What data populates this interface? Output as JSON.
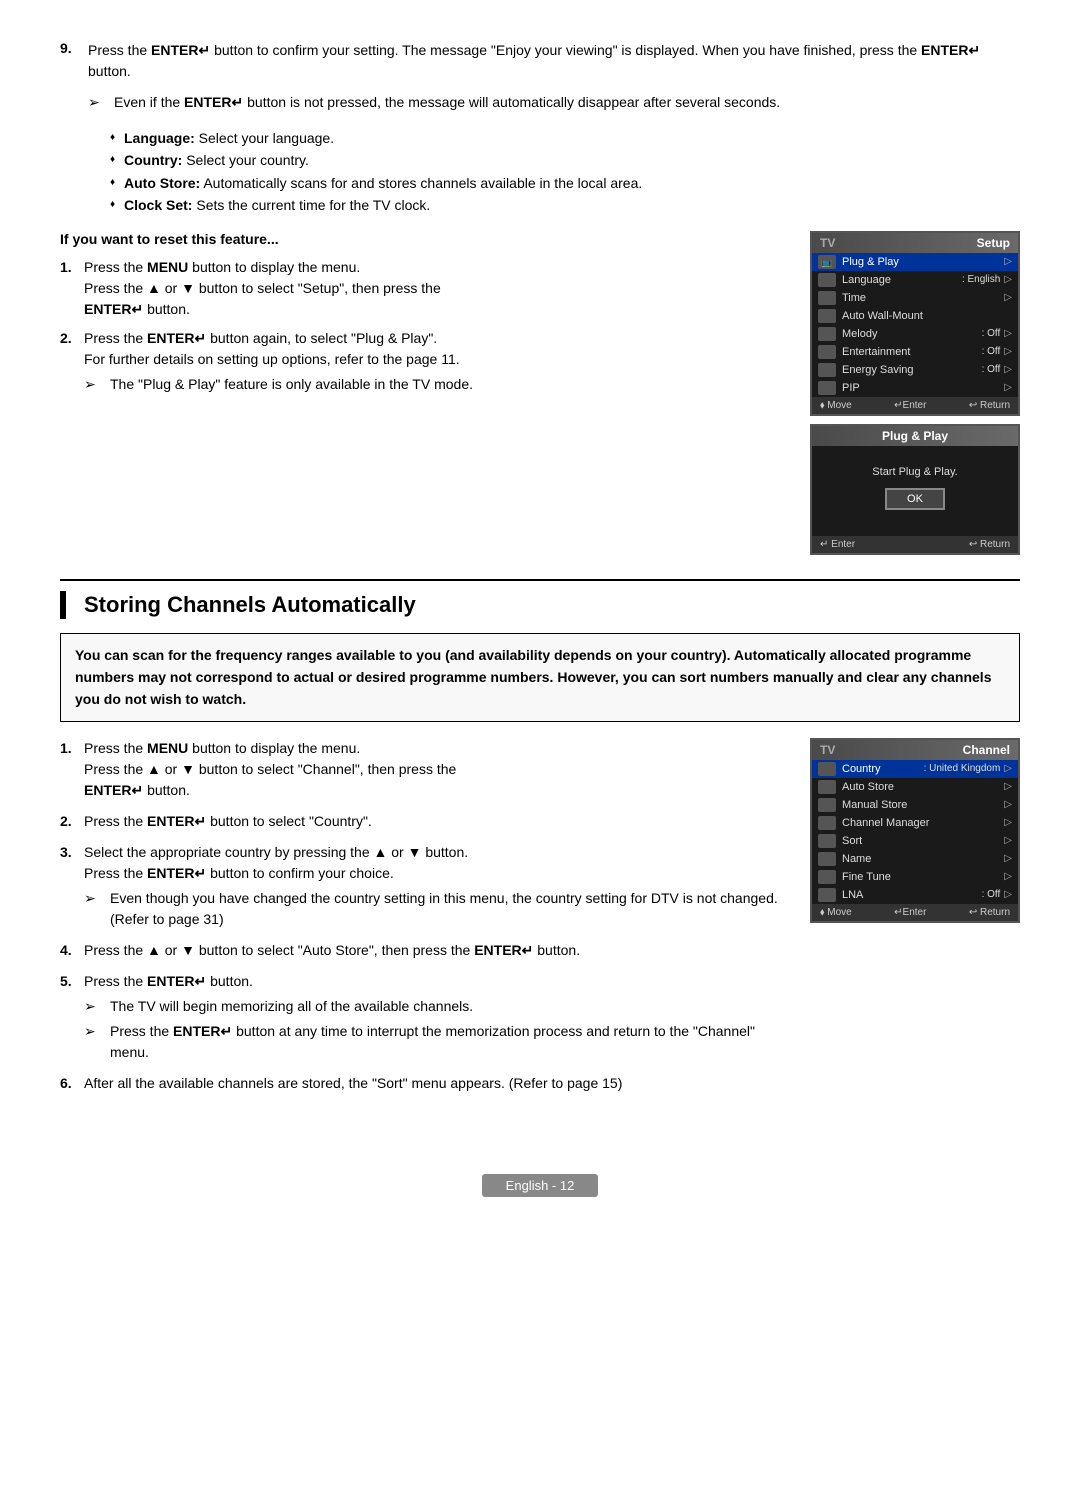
{
  "step9": {
    "number": "9.",
    "text1": "Press the ",
    "enter_label": "ENTER",
    "enter_symbol": "↵",
    "text2": " button to confirm your setting. The message \"Enjoy your viewing\" is displayed. When you have finished, press the ",
    "text3": " button.",
    "subnote": "Even if the ENTER",
    "subnote2": "↵",
    "subnote3": " button is not pressed, the message will automatically disappear after several seconds."
  },
  "bullet_items": [
    {
      "label": "Language:",
      "text": " Select your language."
    },
    {
      "label": "Country:",
      "text": " Select your country."
    },
    {
      "label": "Auto Store:",
      "text": " Automatically scans for and stores channels available in the local area."
    },
    {
      "label": "Clock Set:",
      "text": " Sets the current time for the TV clock."
    }
  ],
  "reset_section": {
    "title": "If you want to reset this feature...",
    "steps": [
      {
        "num": "1.",
        "main": "Press the MENU button to display the menu.",
        "sub1": "Press the ▲ or ▼ button to select \"Setup\", then press the",
        "sub2": "ENTER↵ button."
      },
      {
        "num": "2.",
        "main": "Press the ENTER↵ button again, to select \"Plug & Play\".",
        "note": "For further details on setting up options, refer to the page 11."
      }
    ],
    "tip": "The \"Plug & Play\" feature is only available in the TV mode."
  },
  "setup_menu": {
    "header_tv": "TV",
    "header_section": "Setup",
    "rows": [
      {
        "icon": "📺",
        "label": "Plug & Play",
        "value": "",
        "arrow": "▷",
        "highlight": true
      },
      {
        "icon": "🌐",
        "label": "Language",
        "value": ": English",
        "arrow": "▷",
        "highlight": false
      },
      {
        "icon": "⏰",
        "label": "Time",
        "value": "",
        "arrow": "▷",
        "highlight": false
      },
      {
        "icon": "🖼",
        "label": "Auto Wall-Mount",
        "value": "",
        "arrow": "",
        "highlight": false
      },
      {
        "icon": "♪",
        "label": "Melody",
        "value": ": Off",
        "arrow": "▷",
        "highlight": false
      },
      {
        "icon": "🎭",
        "label": "Entertainment",
        "value": ": Off",
        "arrow": "▷",
        "highlight": false
      },
      {
        "icon": "⚡",
        "label": "Energy Saving",
        "value": ": Off",
        "arrow": "▷",
        "highlight": false
      },
      {
        "icon": "📺",
        "label": "PIP",
        "value": "",
        "arrow": "▷",
        "highlight": false
      }
    ],
    "footer_move": "⬧ Move",
    "footer_enter": "↵Enter",
    "footer_return": "↩ Return"
  },
  "plug_play_menu": {
    "header": "Plug & Play",
    "body_text": "Start Plug & Play.",
    "ok_label": "OK",
    "footer_enter": "↵ Enter",
    "footer_return": "↩ Return"
  },
  "section2": {
    "title": "Storing Channels Automatically",
    "warning": "You can scan for the frequency ranges available to you (and availability depends on your country). Automatically allocated programme numbers may not correspond to actual or desired programme numbers. However, you can sort numbers manually and clear any channels you do not wish to watch.",
    "steps": [
      {
        "num": "1.",
        "main": "Press the MENU button to display the menu.",
        "sub1": "Press the ▲ or ▼ button to select \"Channel\", then press the",
        "sub2": "ENTER↵ button."
      },
      {
        "num": "2.",
        "main": "Press the ENTER↵ button to select \"Country\"."
      },
      {
        "num": "3.",
        "main": "Select the appropriate country by pressing the ▲ or ▼ button.",
        "sub1": "Press the ENTER↵ button to confirm your choice.",
        "note1": "Even though you have changed the country setting in this menu, the country setting for DTV is not changed.",
        "note2": "(Refer to page 31)"
      },
      {
        "num": "4.",
        "main": "Press the ▲ or ▼ button to select \"Auto Store\", then press the ENTER↵ button."
      },
      {
        "num": "5.",
        "main": "Press the ENTER↵ button.",
        "tip1": "The TV will begin memorizing all of the available channels.",
        "tip2": "Press the ENTER↵ button at any time to interrupt the memorization process and return to the \"Channel\" menu."
      },
      {
        "num": "6.",
        "main": "After all the available channels are stored, the \"Sort\" menu appears. (Refer to page 15)"
      }
    ]
  },
  "channel_menu": {
    "header_tv": "TV",
    "header_section": "Channel",
    "rows": [
      {
        "label": "Country",
        "value": ": United Kingdom",
        "arrow": "▷",
        "highlight": true
      },
      {
        "label": "Auto Store",
        "value": "",
        "arrow": "▷",
        "highlight": false
      },
      {
        "label": "Manual Store",
        "value": "",
        "arrow": "▷",
        "highlight": false
      },
      {
        "label": "Channel Manager",
        "value": "",
        "arrow": "▷",
        "highlight": false
      },
      {
        "label": "Sort",
        "value": "",
        "arrow": "▷",
        "highlight": false
      },
      {
        "label": "Name",
        "value": "",
        "arrow": "▷",
        "highlight": false
      },
      {
        "label": "Fine Tune",
        "value": "",
        "arrow": "▷",
        "highlight": false
      },
      {
        "label": "LNA",
        "value": ": Off",
        "arrow": "▷",
        "highlight": false
      }
    ],
    "footer_move": "⬧ Move",
    "footer_enter": "↵Enter",
    "footer_return": "↩ Return"
  },
  "footer": {
    "page_label": "English - 12"
  }
}
